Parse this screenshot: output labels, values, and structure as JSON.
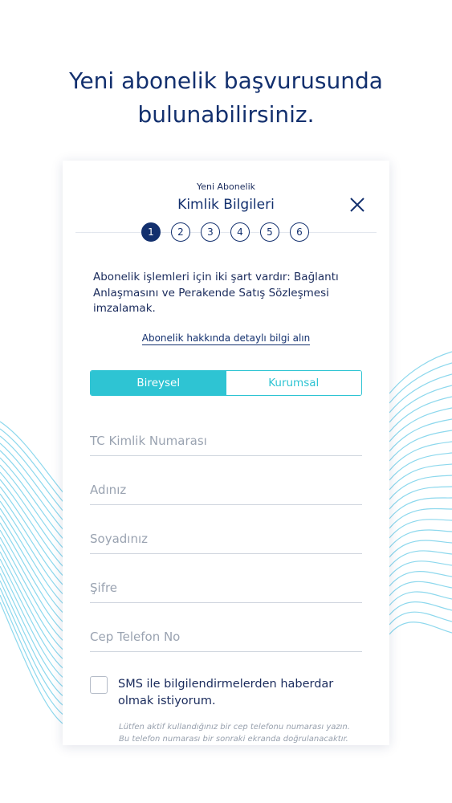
{
  "headline": {
    "line1": "Yeni abonelik başvurusunda",
    "line2": "bulunabilirsiniz."
  },
  "card": {
    "supertitle": "Yeni Abonelik",
    "title": "Kimlik Bilgileri",
    "close_icon": "close-icon",
    "steps": [
      "1",
      "2",
      "3",
      "4",
      "5",
      "6"
    ],
    "active_step": 1,
    "intro_text": "Abonelik işlemleri için iki şart vardır: Bağlantı Anlaşmasını ve Perakende Satış Sözleşmesi imzalamak.",
    "detail_link": "Abonelik hakkında detaylı bilgi alın",
    "segments": {
      "individual": "Bireysel",
      "corporate": "Kurumsal",
      "selected": "individual"
    },
    "fields": {
      "tc_placeholder": "TC Kimlik Numarası",
      "tc_value": "",
      "name_placeholder": "Adınız",
      "name_value": "",
      "surname_placeholder": "Soyadınız",
      "surname_value": "",
      "password_placeholder": "Şifre",
      "password_value": "",
      "phone_placeholder": "Cep Telefon No",
      "phone_value": ""
    },
    "sms_checkbox_label": "SMS ile bilgilendirmelerden haberdar olmak istiyorum.",
    "sms_checked": false,
    "hint_text": "Lütfen aktif kullandığınız bir cep telefonu numarası yazın. Bu telefon numarası bir sonraki ekranda doğrulanacaktır."
  },
  "colors": {
    "navy": "#13306e",
    "turquoise": "#2ec4d3",
    "placeholder": "#9aa3b1"
  }
}
